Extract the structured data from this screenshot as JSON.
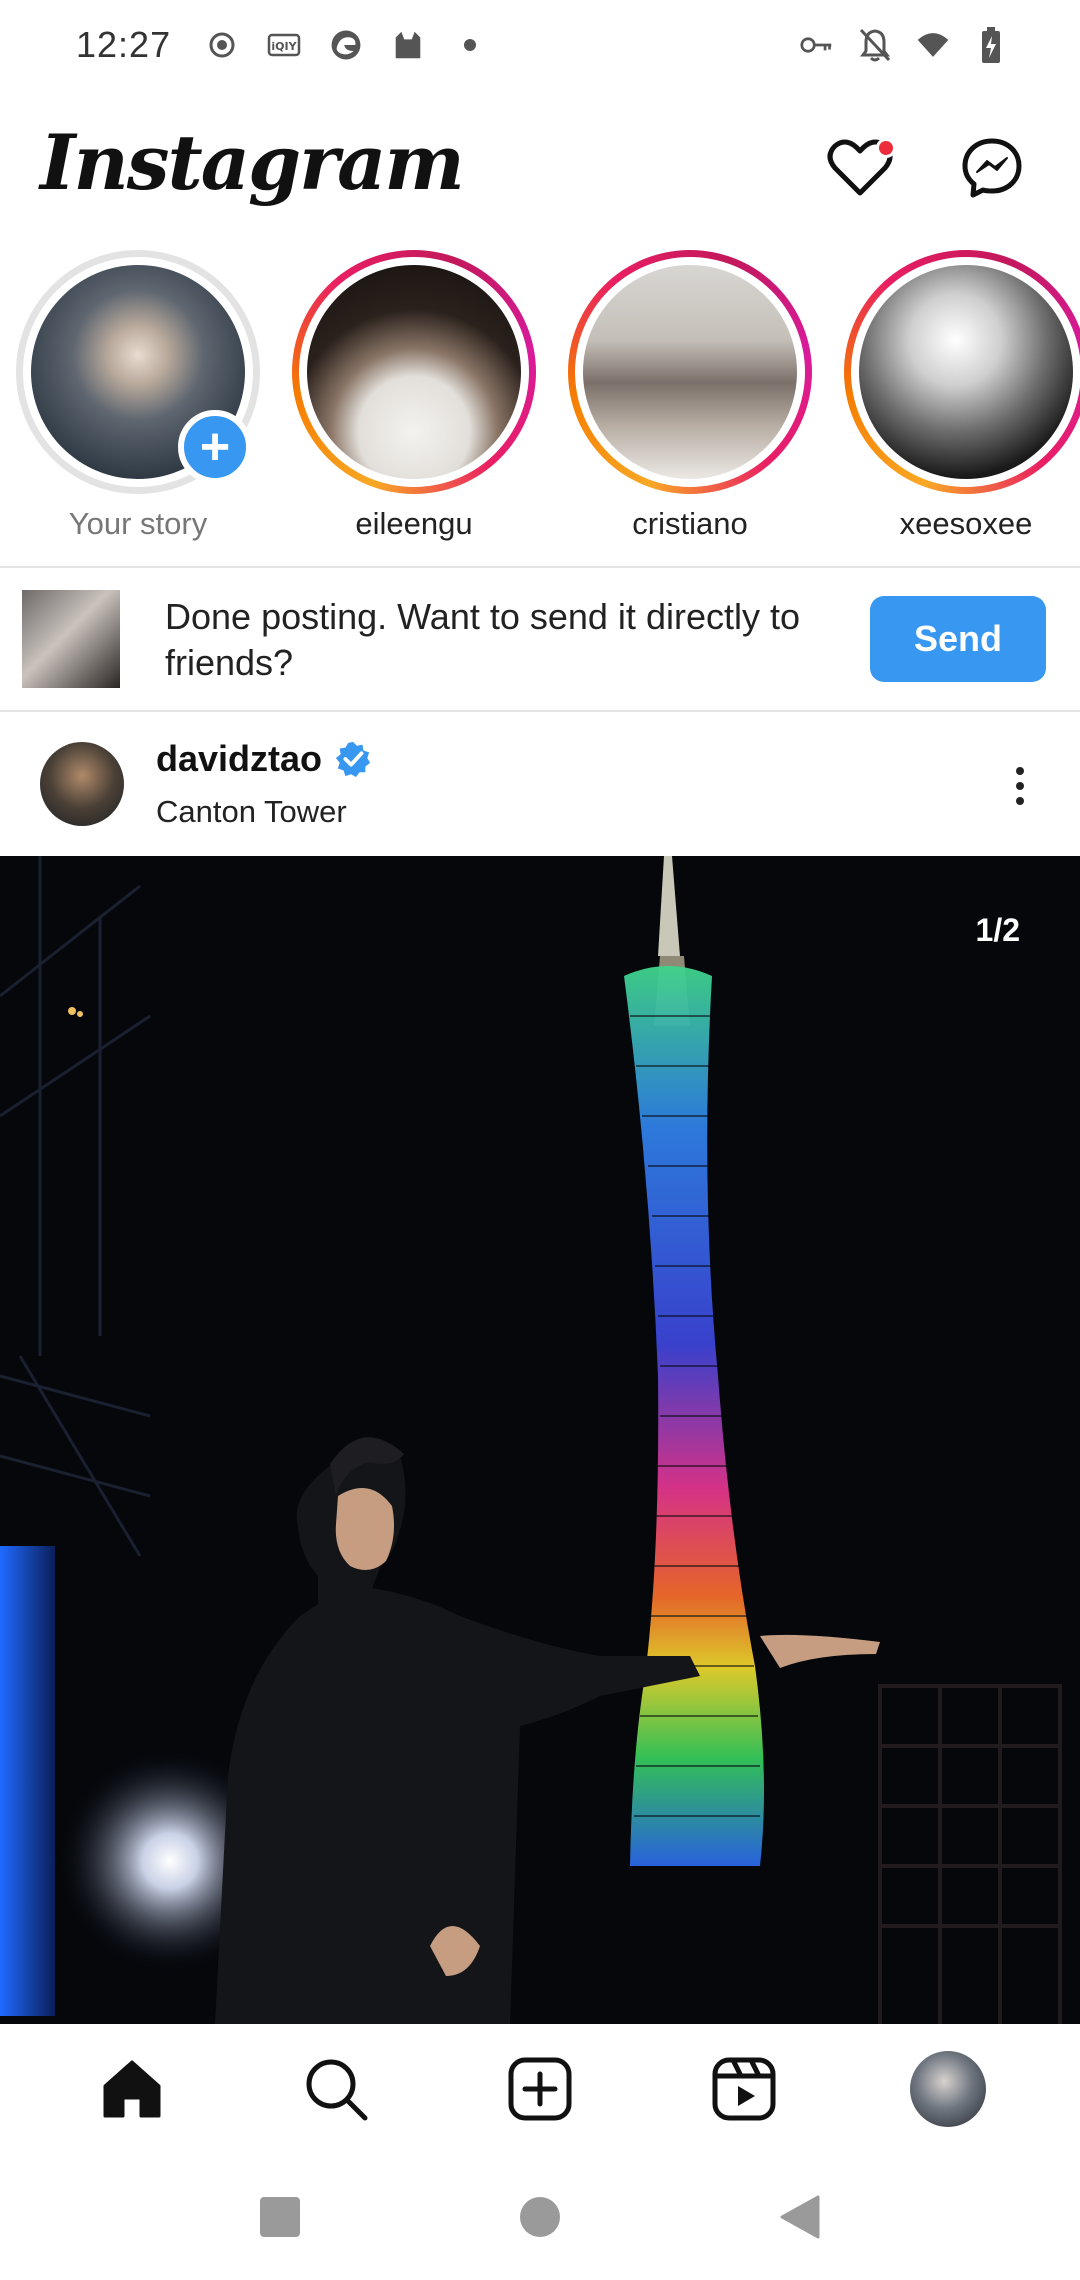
{
  "status_bar": {
    "time": "12:27",
    "left_icons": [
      "record-icon",
      "iqiyi-icon",
      "edge-browser-icon",
      "cat-app-icon",
      "dot-icon"
    ],
    "right_icons": [
      "key-icon",
      "bell-off-icon",
      "wifi-icon",
      "battery-charging-icon"
    ]
  },
  "app": {
    "logo": "Instagram"
  },
  "stories": [
    {
      "label": "Your story",
      "own": true
    },
    {
      "label": "eileengu",
      "own": false
    },
    {
      "label": "cristiano",
      "own": false
    },
    {
      "label": "xeesoxee",
      "own": false
    }
  ],
  "send_prompt": {
    "text": "Done posting. Want to send it directly to friends?",
    "button": "Send"
  },
  "post": {
    "username": "davidztao",
    "location": "Canton Tower",
    "counter": "1/2",
    "verified": true
  },
  "colors": {
    "accent": "#3897f0",
    "notification": "#ed2d3c"
  },
  "bottom_nav": [
    "home-icon",
    "search-icon",
    "create-icon",
    "reels-icon",
    "profile-avatar"
  ],
  "system_nav": [
    "recents-icon",
    "home-circle-icon",
    "back-icon"
  ]
}
